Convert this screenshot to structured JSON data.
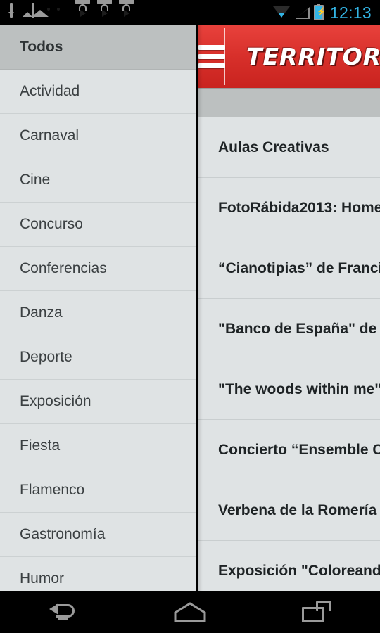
{
  "statusbar": {
    "clock": "12:13",
    "left_icons": [
      "download-icon",
      "gallery-icon",
      "android-icon",
      "play-store-icon",
      "play-store-icon",
      "play-store-icon"
    ],
    "right_icons": [
      "wifi-icon",
      "signal-icon",
      "battery-charging-icon"
    ],
    "accent_color": "#33b5e5"
  },
  "drawer": {
    "items": [
      {
        "label": "Todos",
        "selected": true
      },
      {
        "label": "Actividad",
        "selected": false
      },
      {
        "label": "Carnaval",
        "selected": false
      },
      {
        "label": "Cine",
        "selected": false
      },
      {
        "label": "Concurso",
        "selected": false
      },
      {
        "label": "Conferencias",
        "selected": false
      },
      {
        "label": "Danza",
        "selected": false
      },
      {
        "label": "Deporte",
        "selected": false
      },
      {
        "label": "Exposición",
        "selected": false
      },
      {
        "label": "Fiesta",
        "selected": false
      },
      {
        "label": "Flamenco",
        "selected": false
      },
      {
        "label": "Gastronomía",
        "selected": false
      },
      {
        "label": "Humor",
        "selected": false
      }
    ],
    "background_color": "#dfe3e4",
    "selected_color": "#bcc0c0"
  },
  "actionbar": {
    "menu_icon": "hamburger-icon",
    "title": "TERRITORI",
    "background_color": "#d8302b"
  },
  "list": {
    "items": [
      {
        "title": "Aulas Creativas"
      },
      {
        "title": "FotoRábida2013: Home"
      },
      {
        "title": "“Cianotipias” de Franci"
      },
      {
        "title": "\"Banco de España\" de V"
      },
      {
        "title": "\"The woods within me\""
      },
      {
        "title": "Concierto “Ensemble C"
      },
      {
        "title": "Verbena de la Romería"
      },
      {
        "title": "Exposición \"Coloreand"
      }
    ]
  },
  "navbar": {
    "buttons": [
      {
        "name": "back",
        "icon": "back-arrow-icon"
      },
      {
        "name": "home",
        "icon": "home-icon"
      },
      {
        "name": "recents",
        "icon": "recents-icon"
      }
    ]
  }
}
